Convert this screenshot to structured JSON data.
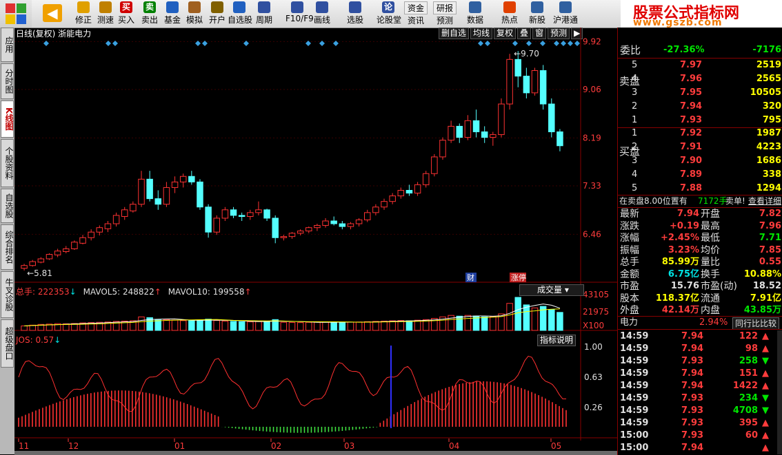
{
  "toolbar": {
    "items": [
      {
        "label": "",
        "icon": "back-arrow-icon",
        "color": "#f0a000"
      },
      {
        "label": "修正",
        "icon": "revise-icon",
        "color": "#e0a000"
      },
      {
        "label": "测速",
        "icon": "clock-icon",
        "color": "#c08000"
      },
      {
        "label": "买入",
        "icon": "buy-icon",
        "color": "#d00000",
        "glyph": "买"
      },
      {
        "label": "卖出",
        "icon": "sell-icon",
        "color": "#008000",
        "glyph": "卖"
      },
      {
        "label": "基金",
        "icon": "fund-icon",
        "color": "#2060c0"
      },
      {
        "label": "模拟",
        "icon": "hammer-icon",
        "color": "#a06020"
      },
      {
        "label": "开户",
        "icon": "lock-icon",
        "color": "#806000"
      },
      {
        "label": "自选股",
        "icon": "star-folder-icon",
        "color": "#2060c0"
      },
      {
        "label": "周期",
        "icon": "clock-icon",
        "color": "#3050a0"
      },
      {
        "label": "F10/F9",
        "icon": "document-icon",
        "color": "#3050a0"
      },
      {
        "label": "画线",
        "icon": "pen-icon",
        "color": "#3050a0"
      },
      {
        "label": "选股",
        "icon": "select-icon",
        "color": "#3050a0"
      },
      {
        "label": "论股堂",
        "icon": "forum-icon",
        "color": "#3050a0",
        "glyph": "论"
      },
      {
        "label": "资讯",
        "icon": "news-icon",
        "color": "#6060a0",
        "top": "资金"
      },
      {
        "label": "预测",
        "icon": "bbd-icon",
        "color": "#2040a0",
        "top": "研报"
      },
      {
        "label": "数据",
        "icon": "pe-icon",
        "color": "#3060a0"
      },
      {
        "label": "热点",
        "icon": "fire-icon",
        "color": "#e04000"
      },
      {
        "label": "新股",
        "icon": "newstock-icon",
        "color": "#3060a0"
      },
      {
        "label": "沪港通",
        "icon": "hk-icon",
        "color": "#3060a0"
      }
    ],
    "bbd": "BBD"
  },
  "logo": {
    "line1": "股票公式指标网",
    "line2": "www.gszb.com"
  },
  "left_tabs": [
    {
      "label": "应用",
      "selected": false
    },
    {
      "label": "分时图",
      "selected": false
    },
    {
      "label": "K线图",
      "selected": true
    },
    {
      "label": "个股资料",
      "selected": false
    },
    {
      "label": "自选股",
      "selected": false
    },
    {
      "label": "综合排名",
      "selected": false
    },
    {
      "label": "牛叉诊股",
      "selected": false
    },
    {
      "label": "超级盘口",
      "selected": false
    }
  ],
  "chart_header": {
    "title": "日线(复权) 浙能电力",
    "buttons": [
      "删自选",
      "均线",
      "复权",
      "叠",
      "窗",
      "预测",
      "▶"
    ]
  },
  "chart_data": [
    {
      "type": "candlestick",
      "name": "price",
      "ylim": [
        5.6,
        9.95
      ],
      "yticks": [
        9.92,
        9.06,
        8.19,
        7.33,
        6.46
      ],
      "annotations": [
        {
          "label": "9.70",
          "value": 9.7
        },
        {
          "label": "5.81",
          "value": 5.81
        },
        {
          "label": "财"
        },
        {
          "label": "涨停"
        }
      ],
      "xlabels": [
        "11",
        "12",
        "01",
        "02",
        "03",
        "04",
        "05"
      ],
      "ohlc": [
        [
          5.85,
          5.93,
          5.81,
          5.9
        ],
        [
          5.9,
          6.0,
          5.88,
          5.97
        ],
        [
          5.96,
          6.05,
          5.94,
          6.02
        ],
        [
          6.02,
          6.12,
          6.0,
          6.1
        ],
        [
          6.09,
          6.2,
          6.05,
          6.16
        ],
        [
          6.15,
          6.25,
          6.12,
          6.2
        ],
        [
          6.2,
          6.35,
          6.18,
          6.32
        ],
        [
          6.3,
          6.45,
          6.28,
          6.4
        ],
        [
          6.4,
          6.55,
          6.35,
          6.5
        ],
        [
          6.5,
          6.62,
          6.44,
          6.58
        ],
        [
          6.56,
          6.7,
          6.5,
          6.65
        ],
        [
          6.65,
          6.85,
          6.6,
          6.8
        ],
        [
          6.78,
          6.95,
          6.72,
          6.9
        ],
        [
          6.88,
          7.05,
          6.85,
          7.0
        ],
        [
          7.0,
          7.6,
          6.95,
          7.45
        ],
        [
          7.45,
          7.6,
          7.05,
          7.1
        ],
        [
          7.1,
          7.25,
          6.9,
          7.0
        ],
        [
          7.0,
          7.4,
          6.95,
          7.3
        ],
        [
          7.3,
          7.5,
          7.2,
          7.4
        ],
        [
          7.4,
          7.55,
          7.3,
          7.5
        ],
        [
          7.5,
          7.6,
          7.35,
          7.4
        ],
        [
          7.4,
          7.45,
          6.9,
          6.95
        ],
        [
          6.95,
          7.0,
          6.4,
          6.5
        ],
        [
          6.5,
          6.8,
          6.45,
          6.75
        ],
        [
          6.75,
          6.95,
          6.7,
          6.9
        ],
        [
          6.9,
          6.95,
          6.75,
          6.8
        ],
        [
          6.8,
          6.85,
          6.7,
          6.78
        ],
        [
          6.78,
          6.9,
          6.72,
          6.85
        ],
        [
          6.85,
          7.05,
          6.8,
          6.9
        ],
        [
          6.9,
          6.92,
          6.7,
          6.75
        ],
        [
          6.75,
          6.8,
          6.3,
          6.4
        ],
        [
          6.4,
          6.45,
          6.35,
          6.42
        ],
        [
          6.42,
          6.5,
          6.38,
          6.48
        ],
        [
          6.48,
          6.55,
          6.44,
          6.52
        ],
        [
          6.52,
          6.6,
          6.48,
          6.58
        ],
        [
          6.58,
          6.65,
          6.52,
          6.62
        ],
        [
          6.62,
          6.75,
          6.58,
          6.7
        ],
        [
          6.7,
          6.78,
          6.62,
          6.65
        ],
        [
          6.65,
          6.7,
          6.55,
          6.6
        ],
        [
          6.6,
          6.68,
          6.55,
          6.65
        ],
        [
          6.65,
          6.75,
          6.6,
          6.72
        ],
        [
          6.72,
          6.9,
          6.68,
          6.85
        ],
        [
          6.85,
          7.0,
          6.8,
          6.95
        ],
        [
          6.95,
          7.1,
          6.9,
          7.05
        ],
        [
          7.05,
          7.2,
          7.0,
          7.15
        ],
        [
          7.15,
          7.3,
          7.1,
          7.25
        ],
        [
          7.25,
          7.35,
          7.15,
          7.2
        ],
        [
          7.2,
          7.4,
          7.15,
          7.35
        ],
        [
          7.35,
          7.6,
          7.3,
          7.55
        ],
        [
          7.55,
          7.9,
          7.5,
          7.85
        ],
        [
          7.85,
          8.2,
          7.8,
          8.15
        ],
        [
          8.15,
          8.5,
          8.1,
          8.4
        ],
        [
          8.4,
          8.45,
          8.1,
          8.2
        ],
        [
          8.2,
          8.6,
          8.15,
          8.5
        ],
        [
          8.5,
          8.7,
          8.2,
          8.3
        ],
        [
          8.3,
          8.4,
          8.1,
          8.2
        ],
        [
          8.2,
          8.3,
          8.05,
          8.25
        ],
        [
          8.25,
          8.9,
          8.2,
          8.8
        ],
        [
          8.8,
          9.7,
          8.7,
          9.6
        ],
        [
          9.6,
          9.75,
          9.1,
          9.3
        ],
        [
          9.3,
          9.45,
          8.9,
          9.0
        ],
        [
          9.0,
          9.45,
          8.95,
          9.4
        ],
        [
          9.4,
          9.5,
          8.7,
          8.8
        ],
        [
          8.8,
          8.9,
          8.2,
          8.3
        ],
        [
          8.3,
          8.35,
          7.95,
          8.05
        ]
      ]
    },
    {
      "type": "bar",
      "name": "成交量",
      "labels": [
        "总手: 222353",
        "MAVOL5: 248822",
        "MAVOL10: 199558"
      ],
      "yticks": [
        "43105",
        "21975",
        "X100"
      ],
      "values": [
        3,
        3.5,
        4,
        4.2,
        4.5,
        4.4,
        4.6,
        5,
        5.2,
        5.4,
        5.6,
        6,
        6.2,
        6.4,
        9,
        8.5,
        7,
        7.2,
        6.8,
        6.5,
        6.4,
        7,
        7.5,
        6.6,
        6.2,
        6,
        5.8,
        5.7,
        5.9,
        6.2,
        7.2,
        5.4,
        5.3,
        5.2,
        5.4,
        5.5,
        5.6,
        5.5,
        5.4,
        5.5,
        5.6,
        5.8,
        6,
        6.2,
        6.4,
        6.6,
        6.4,
        6.8,
        7.2,
        8,
        9,
        10,
        9.5,
        10,
        9.6,
        9,
        9.2,
        11,
        18,
        22,
        17,
        15,
        16,
        14,
        12
      ]
    },
    {
      "type": "line+bar",
      "name": "JOS",
      "label": "JOS: 0.57",
      "button": "指标说明",
      "yticks": [
        "1.00",
        "0.63",
        "0.26"
      ]
    }
  ],
  "right_panel": {
    "weibi": {
      "label": "委比",
      "pct": "-27.36%",
      "val": "-7176"
    },
    "sell_label": "卖盘",
    "buy_label": "买盘",
    "sell": [
      {
        "n": "5",
        "p": "7.97",
        "v": "2519"
      },
      {
        "n": "4",
        "p": "7.96",
        "v": "2565"
      },
      {
        "n": "3",
        "p": "7.95",
        "v": "10505"
      },
      {
        "n": "2",
        "p": "7.94",
        "v": "320"
      },
      {
        "n": "1",
        "p": "7.93",
        "v": "795"
      }
    ],
    "buy": [
      {
        "n": "1",
        "p": "7.92",
        "v": "1987"
      },
      {
        "n": "2",
        "p": "7.91",
        "v": "4223"
      },
      {
        "n": "3",
        "p": "7.90",
        "v": "1686"
      },
      {
        "n": "4",
        "p": "7.89",
        "v": "338"
      },
      {
        "n": "5",
        "p": "7.88",
        "v": "1294"
      }
    ],
    "notice": {
      "a": "在卖盘8.00位置有",
      "b": "7172手",
      "c": "卖单!",
      "d": "查看详细"
    },
    "stats": [
      {
        "l1": "最新",
        "v1": "7.94",
        "c1": "r",
        "l2": "开盘",
        "v2": "7.82",
        "c2": "r"
      },
      {
        "l1": "涨跌",
        "v1": "+0.19",
        "c1": "r",
        "l2": "最高",
        "v2": "7.96",
        "c2": "r"
      },
      {
        "l1": "涨幅",
        "v1": "+2.45%",
        "c1": "r",
        "l2": "最低",
        "v2": "7.71",
        "c2": "g"
      },
      {
        "l1": "振幅",
        "v1": "3.23%",
        "c1": "r",
        "l2": "均价",
        "v2": "7.85",
        "c2": "r"
      },
      {
        "l1": "总手",
        "v1": "85.99万",
        "c1": "y",
        "l2": "量比",
        "v2": "0.55",
        "c2": "r"
      },
      {
        "l1": "金额",
        "v1": "6.75亿",
        "c1": "c",
        "l2": "换手",
        "v2": "10.88%",
        "c2": "y"
      },
      {
        "l1": "市盈",
        "v1": "15.76",
        "c1": "w",
        "l2": "市盈(动)",
        "v2": "18.52",
        "c2": "w"
      },
      {
        "l1": "股本",
        "v1": "118.37亿",
        "c1": "y",
        "l2": "流通",
        "v2": "7.91亿",
        "c2": "y"
      },
      {
        "l1": "外盘",
        "v1": "42.14万",
        "c1": "r",
        "l2": "内盘",
        "v2": "43.85万",
        "c2": "g"
      }
    ],
    "sector": {
      "name": "电力",
      "pct": "2.94%",
      "btn": "同行比比较"
    },
    "ticks": [
      {
        "t": "14:59",
        "p": "7.94",
        "v": "122",
        "d": "up"
      },
      {
        "t": "14:59",
        "p": "7.94",
        "v": "98",
        "d": "up"
      },
      {
        "t": "14:59",
        "p": "7.93",
        "v": "258",
        "d": "down"
      },
      {
        "t": "14:59",
        "p": "7.94",
        "v": "151",
        "d": "up"
      },
      {
        "t": "14:59",
        "p": "7.94",
        "v": "1422",
        "d": "up"
      },
      {
        "t": "14:59",
        "p": "7.93",
        "v": "234",
        "d": "down"
      },
      {
        "t": "14:59",
        "p": "7.93",
        "v": "4708",
        "d": "down"
      },
      {
        "t": "14:59",
        "p": "7.93",
        "v": "395",
        "d": "up"
      },
      {
        "t": "15:00",
        "p": "7.93",
        "v": "60",
        "d": "up"
      },
      {
        "t": "15:00",
        "p": "7.94",
        "v": "",
        "d": "up"
      }
    ]
  }
}
